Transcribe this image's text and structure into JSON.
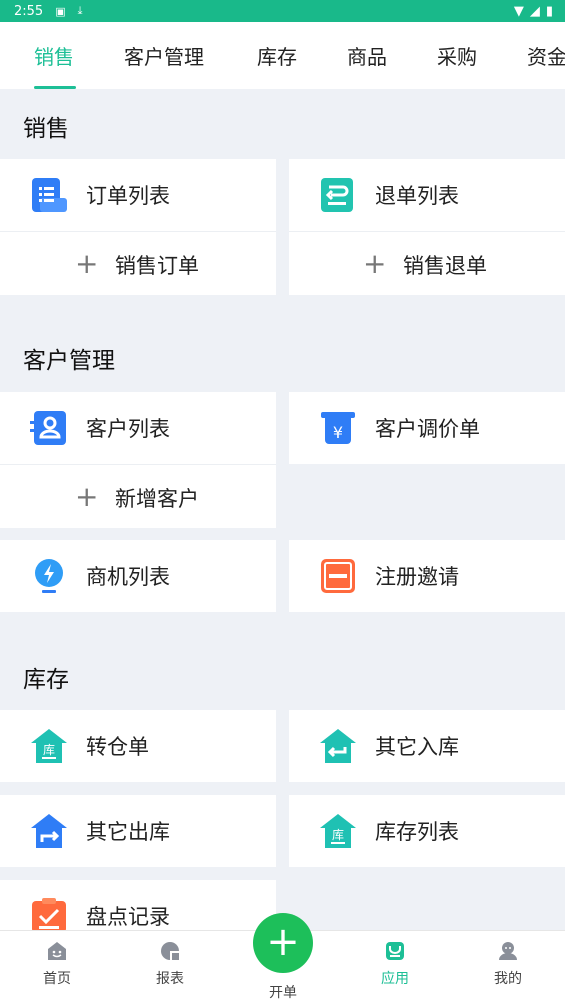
{
  "status_bar": {
    "time": "2:55"
  },
  "tabs": [
    "销售",
    "客户管理",
    "库存",
    "商品",
    "采购",
    "资金"
  ],
  "sections": {
    "sales": {
      "title": "销售",
      "order_list": "订单列表",
      "return_list": "退单列表",
      "new_sales_order": "销售订单",
      "new_sales_return": "销售退单"
    },
    "customer": {
      "title": "客户管理",
      "customer_list": "客户列表",
      "price_adjust": "客户调价单",
      "new_customer": "新增客户",
      "opportunity_list": "商机列表",
      "invite": "注册邀请"
    },
    "inventory": {
      "title": "库存",
      "transfer": "转仓单",
      "other_in": "其它入库",
      "other_out": "其它出库",
      "stock_list": "库存列表",
      "stocktake": "盘点记录"
    }
  },
  "bottom_nav": {
    "home": "首页",
    "reports": "报表",
    "create": "开单",
    "apps": "应用",
    "mine": "我的"
  },
  "colors": {
    "accent": "#1dbf96",
    "status_bar": "#19b98a",
    "fab": "#1dbf5a"
  }
}
